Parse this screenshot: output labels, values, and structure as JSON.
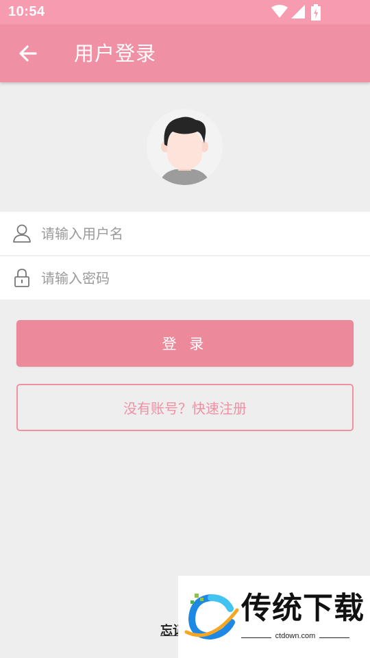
{
  "status_bar": {
    "time": "10:54",
    "icons": [
      "wifi-icon",
      "signal-icon",
      "battery-icon"
    ]
  },
  "app_bar": {
    "back_icon": "arrow-left-icon",
    "title": "用户登录"
  },
  "avatar": {
    "icon": "user-avatar"
  },
  "form": {
    "username": {
      "icon": "user-outline-icon",
      "placeholder": "请输入用户名",
      "value": ""
    },
    "password": {
      "icon": "lock-icon",
      "placeholder": "请输入密码",
      "value": ""
    }
  },
  "buttons": {
    "login_label": "登 录",
    "register_label": "没有账号？快速注册"
  },
  "forgot_password": {
    "label": "忘记"
  },
  "watermark": {
    "name": "传统下载",
    "url": "ctdown.com"
  },
  "colors": {
    "status_bar": "#f69bb0",
    "app_bar": "#f090a4",
    "login_button": "#ec8a9c",
    "accent": "#f090a4",
    "background": "#eeeeee"
  }
}
